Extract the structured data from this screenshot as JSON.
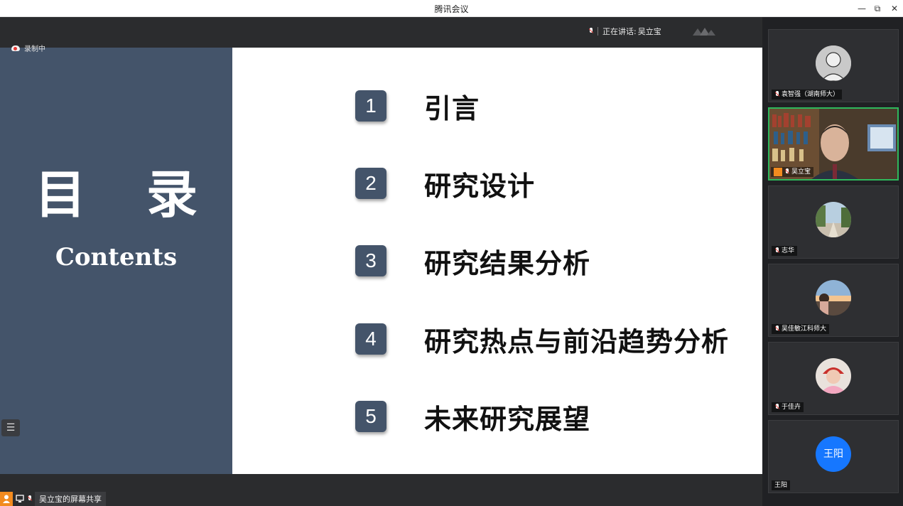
{
  "window": {
    "title": "腾讯会议"
  },
  "status": {
    "speaking_prefix": "正在讲话:",
    "speaker": "吴立宝",
    "recording": "录制中"
  },
  "slide": {
    "title": "目 录",
    "subtitle": "Contents",
    "items": [
      {
        "num": "1",
        "label": "引言"
      },
      {
        "num": "2",
        "label": "研究设计"
      },
      {
        "num": "3",
        "label": "研究结果分析"
      },
      {
        "num": "4",
        "label": "研究热点与前沿趋势分析"
      },
      {
        "num": "5",
        "label": "未来研究展望"
      }
    ]
  },
  "share": {
    "label": "吴立宝的屏幕共享"
  },
  "participants": [
    {
      "name": "袁智强（湖南师大）",
      "avatar": "sketch-avatar"
    },
    {
      "name": "吴立宝",
      "avatar": "video-feed"
    },
    {
      "name": "志华",
      "avatar": "street-photo-avatar"
    },
    {
      "name": "吴佳敏江科师大",
      "avatar": "sunset-photo-avatar"
    },
    {
      "name": "于佳卉",
      "avatar": "pink-photo-avatar"
    },
    {
      "name": "王阳",
      "avatar_text": "王阳"
    }
  ],
  "colors": {
    "slide_accent": "#44546a",
    "active_border": "#2eb85c",
    "avatar_blue": "#1677ff",
    "user_icon": "#f28b1f"
  }
}
